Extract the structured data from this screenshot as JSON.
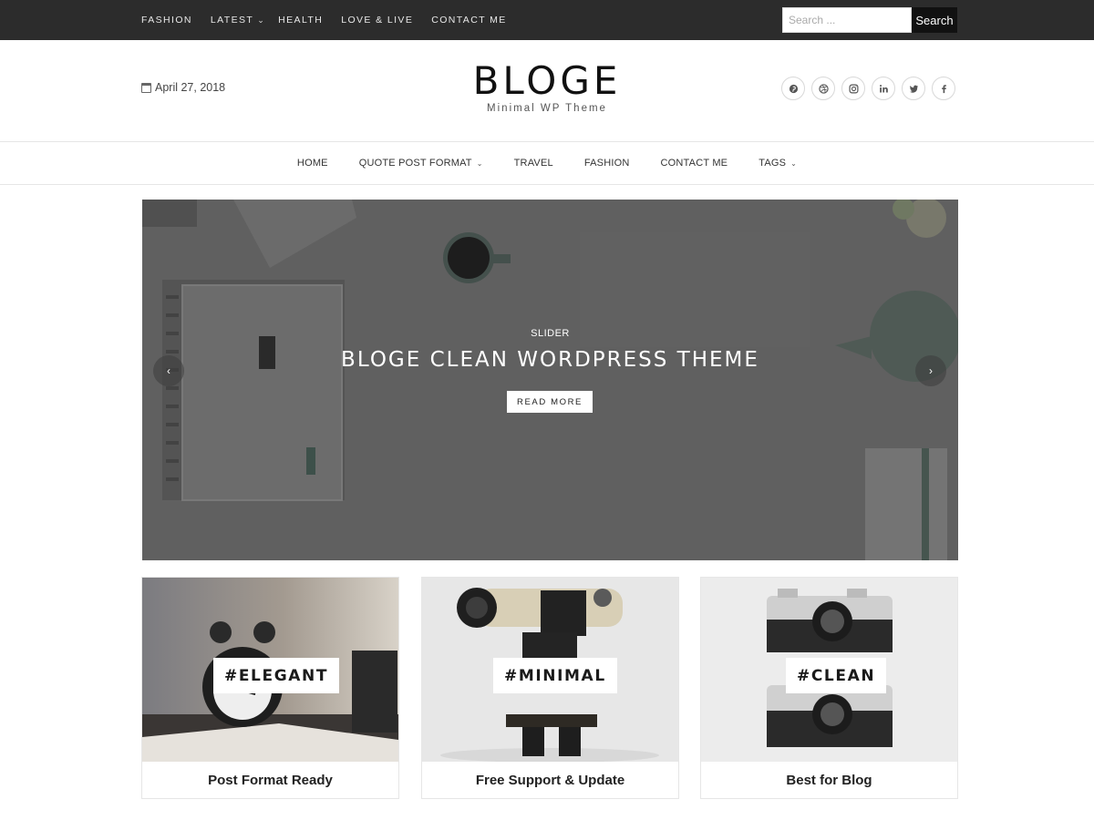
{
  "topbar": {
    "nav": [
      {
        "label": "FASHION"
      },
      {
        "label": "LATEST",
        "has_dropdown": true
      },
      {
        "label": "HEALTH"
      },
      {
        "label": "LOVE & LIVE"
      },
      {
        "label": "CONTACT ME"
      }
    ],
    "search": {
      "placeholder": "Search ...",
      "button_label": "Search"
    }
  },
  "header": {
    "date": "April 27, 2018",
    "logo": "BLOGE",
    "tagline": "Minimal WP Theme",
    "social": [
      {
        "icon": "pinterest-icon",
        "glyph": "p"
      },
      {
        "icon": "dribbble-icon",
        "glyph": "◎"
      },
      {
        "icon": "instagram-icon",
        "glyph": "▢"
      },
      {
        "icon": "linkedin-icon",
        "glyph": "in"
      },
      {
        "icon": "twitter-icon",
        "glyph": "t"
      },
      {
        "icon": "facebook-icon",
        "glyph": "f"
      }
    ]
  },
  "mainnav": {
    "items": [
      {
        "label": "HOME"
      },
      {
        "label": "QUOTE POST FORMAT",
        "has_dropdown": true
      },
      {
        "label": "TRAVEL"
      },
      {
        "label": "FASHION"
      },
      {
        "label": "CONTACT ME"
      },
      {
        "label": "TAGS",
        "has_dropdown": true
      }
    ]
  },
  "slider": {
    "category": "SLIDER",
    "title": "BLOGE CLEAN WORDPRESS THEME",
    "button_label": "READ MORE",
    "prev_glyph": "‹",
    "next_glyph": "›"
  },
  "cards": [
    {
      "tag": "#ELEGANT",
      "title": "Post Format Ready"
    },
    {
      "tag": "#MINIMAL",
      "title": "Free Support & Update"
    },
    {
      "tag": "#CLEAN",
      "title": "Best for Blog"
    }
  ],
  "colors": {
    "topbar_bg": "#2c2c2c",
    "search_button_bg": "#111111",
    "slider_bg": "#6e6e6e"
  }
}
